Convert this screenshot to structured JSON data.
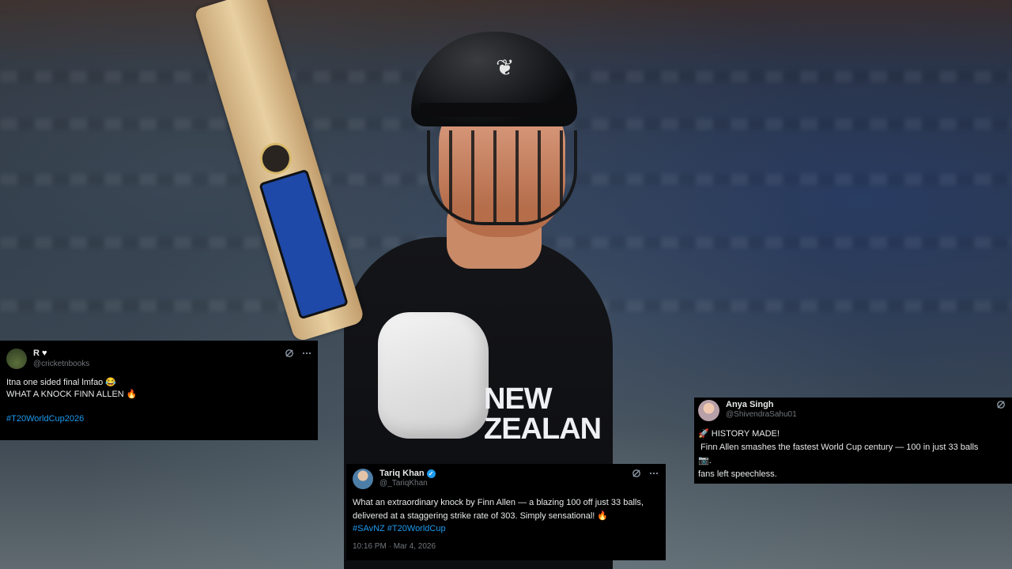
{
  "background": {
    "jersey_text": "NEW ZEALAN"
  },
  "tweets": [
    {
      "id": "t1",
      "name": "R",
      "name_icon": "heart-icon",
      "handle": "@cricketnbooks",
      "lines": [
        "Itna one sided final lmfao 😂",
        "WHAT A KNOCK FINN ALLEN 🔥"
      ],
      "hashtags": "#T20WorldCup2026"
    },
    {
      "id": "t2",
      "name": "Tariq Khan",
      "verified": true,
      "handle": "@_TariqKhan",
      "body": "What an extraordinary knock by Finn Allen — a blazing 100 off just 33 balls, delivered at a staggering strike rate of 303. Simply sensational! 🔥",
      "hashtags": "#SAvNZ #T20WorldCup",
      "timestamp": "10:16 PM · Mar 4, 2026"
    },
    {
      "id": "t3",
      "name": "Anya Singh",
      "handle": "@ShivendraSahu01",
      "lines": [
        "🚀 HISTORY MADE!",
        " Finn Allen smashes the fastest World Cup century — 100 in just 33 balls",
        "📷.",
        "fans left speechless."
      ]
    }
  ],
  "icons": {
    "grok": "grok-icon",
    "more": "more-icon",
    "verified": "verified-badge-icon"
  },
  "colors": {
    "card_bg": "#000000",
    "text": "#e7e9ea",
    "handle": "#71767b",
    "link": "#1d9bf0"
  }
}
